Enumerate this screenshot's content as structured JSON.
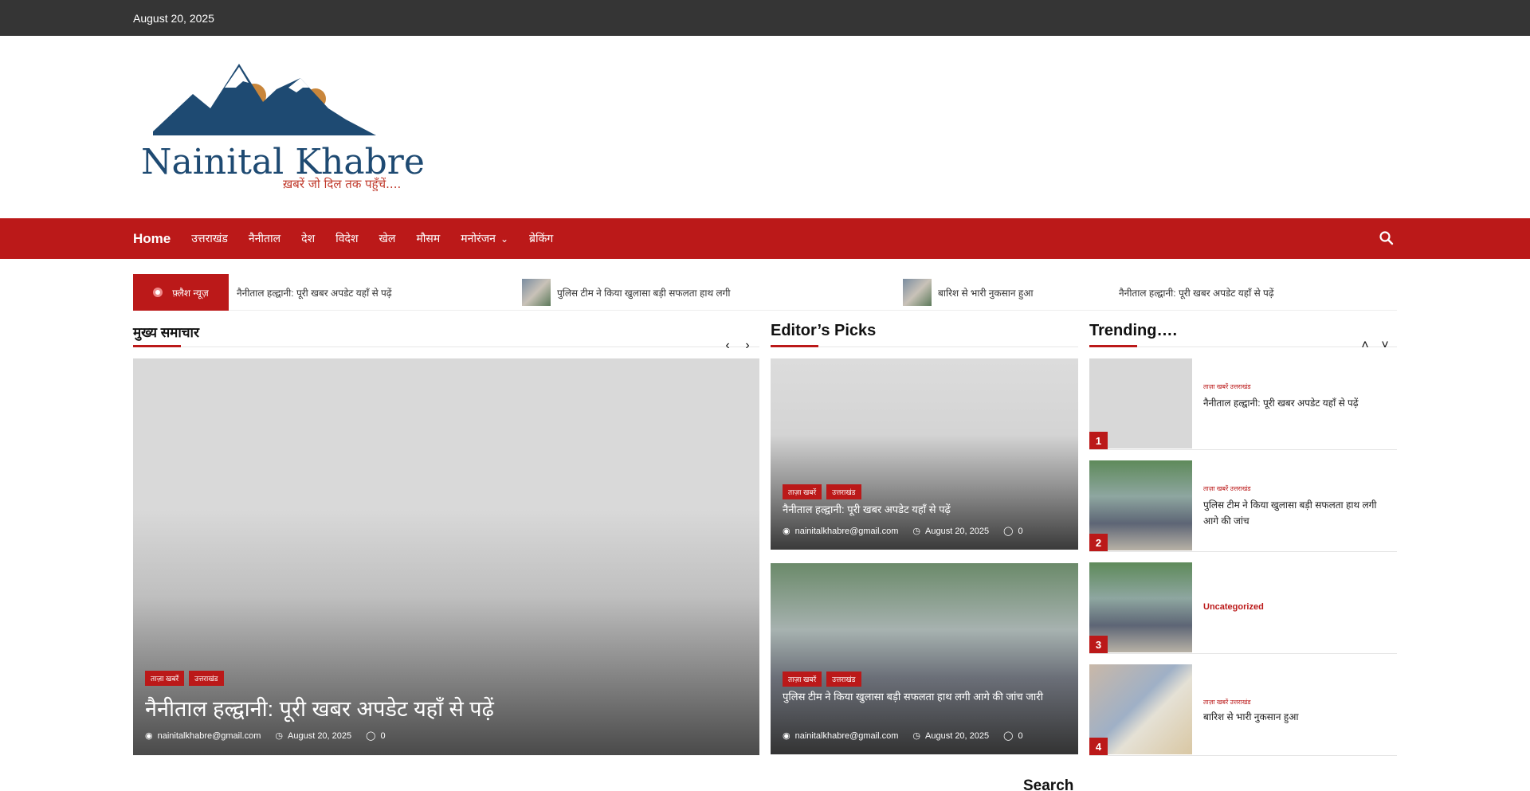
{
  "topbar": {
    "date": "August 20, 2025"
  },
  "logo": {
    "name": "Nainital Khabre",
    "tagline": "ख़बरें जो दिल तक पहुँचें...."
  },
  "nav": {
    "home": "Home",
    "items": [
      "उत्तराखंड",
      "नैनीताल",
      "देश",
      "विदेश",
      "खेल",
      "मौसम",
      "मनोरंजन",
      "ब्रेकिंग"
    ],
    "search_icon": "search-icon"
  },
  "ticker": {
    "label": "फ़्लैश न्यूज़",
    "items": [
      "नैनीताल हल्द्वानी: पूरी खबर अपडेट यहाँ से पढ़ें",
      "पुलिस टीम ने किया खुलासा बड़ी सफलता हाथ लगी",
      "बारिश से भारी नुकसान हुआ",
      "नैनीताल हल्द्वानी: पूरी खबर अपडेट यहाँ से पढ़ें"
    ]
  },
  "main_slider": {
    "section_title": "मुख्य समाचार",
    "badges": [
      "ताज़ा खबरें",
      "उत्तराखंड"
    ],
    "title": "नैनीताल हल्द्वानी: पूरी खबर अपडेट यहाँ से पढ़ें",
    "author": "nainitalkhabre@gmail.com",
    "date": "August 20, 2025",
    "comments": "0"
  },
  "editors_picks": {
    "section_title": "Editor’s Picks",
    "items": [
      {
        "badges": [
          "ताज़ा खबरें",
          "उत्तराखंड"
        ],
        "title": "नैनीताल हल्द्वानी: पूरी खबर अपडेट यहाँ से पढ़ें",
        "author": "nainitalkhabre@gmail.com",
        "date": "August 20, 2025",
        "comments": "0"
      },
      {
        "badges": [
          "ताज़ा खबरें",
          "उत्तराखंड"
        ],
        "title": "पुलिस टीम ने किया खुलासा बड़ी सफलता हाथ लगी आगे की जांच जारी",
        "author": "nainitalkhabre@gmail.com",
        "date": "August 20, 2025",
        "comments": "0"
      }
    ]
  },
  "trending": {
    "section_title": "Trending….",
    "items": [
      {
        "rank": "1",
        "cats": "ताज़ा खबरें  उत्तराखंड",
        "title": "नैनीताल हल्द्वानी: पूरी खबर अपडेट यहाँ से पढ़ें"
      },
      {
        "rank": "2",
        "cats": "ताज़ा खबरें  उत्तराखंड",
        "title": "पुलिस टीम ने किया खुलासा बड़ी सफलता हाथ लगी आगे की जांच"
      },
      {
        "rank": "3",
        "cats": "",
        "title": "Uncategorized"
      },
      {
        "rank": "4",
        "cats": "ताज़ा खबरें  उत्तराखंड",
        "title": "बारिश से भारी नुकसान हुआ"
      }
    ]
  },
  "sidebar": {
    "search_label": "Search"
  },
  "colors": {
    "brand_red": "#bb1919",
    "topbar": "#353535",
    "logo_blue": "#1e4a72",
    "logo_orange": "#c9863b"
  }
}
